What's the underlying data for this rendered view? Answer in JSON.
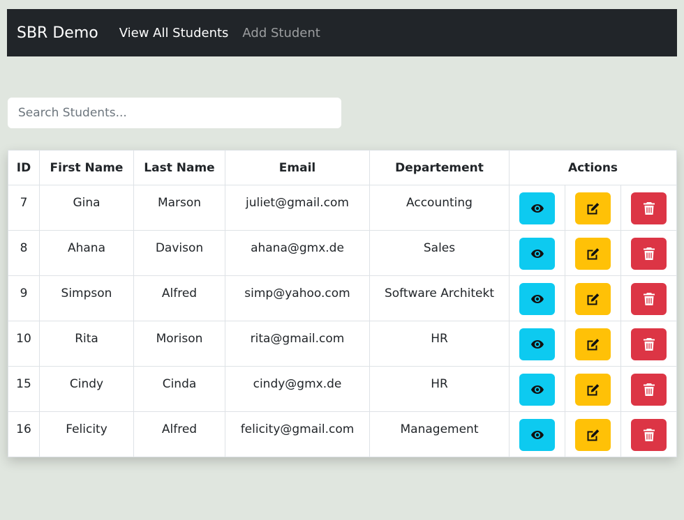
{
  "navbar": {
    "brand": "SBR Demo",
    "links": [
      {
        "label": "View All Students"
      },
      {
        "label": "Add Student"
      }
    ]
  },
  "search": {
    "placeholder": "Search Students..."
  },
  "table": {
    "headers": [
      "ID",
      "First Name",
      "Last Name",
      "Email",
      "Departement",
      "Actions"
    ],
    "rows": [
      {
        "id": "7",
        "first": "Gina",
        "last": "Marson",
        "email": "juliet@gmail.com",
        "dept": "Accounting"
      },
      {
        "id": "8",
        "first": "Ahana",
        "last": "Davison",
        "email": "ahana@gmx.de",
        "dept": "Sales"
      },
      {
        "id": "9",
        "first": "Simpson",
        "last": "Alfred",
        "email": "simp@yahoo.com",
        "dept": "Software Architekt"
      },
      {
        "id": "10",
        "first": "Rita",
        "last": "Morison",
        "email": "rita@gmail.com",
        "dept": "HR"
      },
      {
        "id": "15",
        "first": "Cindy",
        "last": "Cinda",
        "email": "cindy@gmx.de",
        "dept": "HR"
      },
      {
        "id": "16",
        "first": "Felicity",
        "last": "Alfred",
        "email": "felicity@gmail.com",
        "dept": "Management"
      }
    ],
    "action_icons": [
      "eye-icon",
      "edit-icon",
      "trash-icon"
    ]
  },
  "colors": {
    "navbar": "#212529",
    "view_button": "#0dcaf0",
    "edit_button": "#ffc107",
    "delete_button": "#dc3545",
    "background": "#e0e6df"
  }
}
